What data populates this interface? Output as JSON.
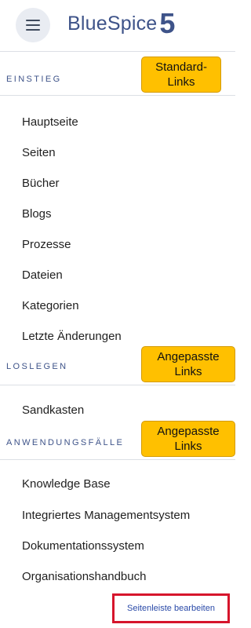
{
  "header": {
    "menu_icon": "hamburger-menu-icon",
    "logo_text": "BlueSpice",
    "logo_version": "5"
  },
  "sections": [
    {
      "heading": "EINSTIEG",
      "callout": "Standard-Links",
      "items": [
        "Hauptseite",
        "Seiten",
        "Bücher",
        "Blogs",
        "Prozesse",
        "Dateien",
        "Kategorien",
        "Letzte Änderungen"
      ]
    },
    {
      "heading": "LOSLEGEN",
      "callout": "Angepasste Links",
      "items": [
        "Sandkasten"
      ]
    },
    {
      "heading": "ANWENDUNGSFÄLLE",
      "callout": "Angepasste Links",
      "items": [
        "Knowledge Base",
        "Integriertes Managementsystem",
        "Dokumentationssystem",
        "Organisationshandbuch"
      ]
    }
  ],
  "edit_link": "Seitenleiste bearbeiten",
  "colors": {
    "brand": "#3e5389",
    "callout": "#ffc000",
    "highlight_border": "#d6152c",
    "link": "#2a4aa8"
  }
}
